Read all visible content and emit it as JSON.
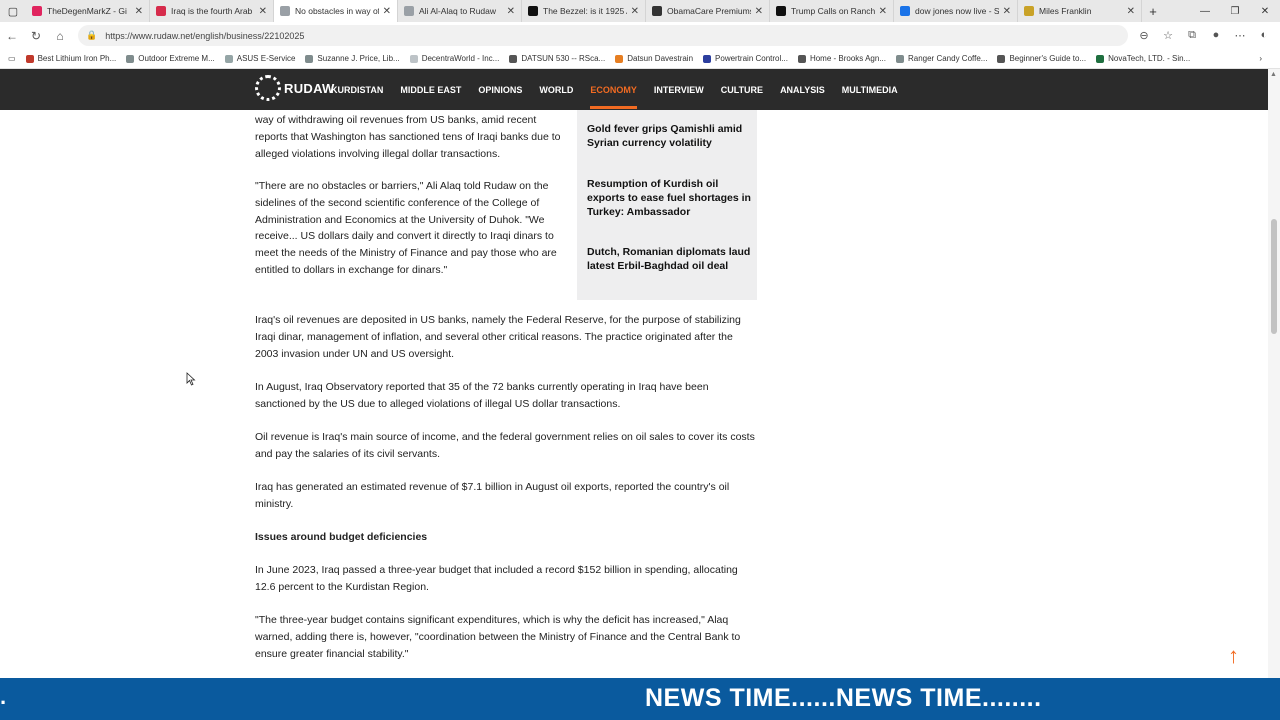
{
  "browser": {
    "tabs": [
      {
        "title": "TheDegenMarkZ - Gi",
        "color": "#e0245e",
        "active": false
      },
      {
        "title": "Iraq is the fourth Arab",
        "color": "#d62b4b",
        "active": false
      },
      {
        "title": "No obstacles in way of",
        "color": "#9aa0a6",
        "active": true
      },
      {
        "title": "Ali Al-Alaq to Rudaw",
        "color": "#9aa0a6",
        "active": false
      },
      {
        "title": "The Bezzel: is it 1925 A",
        "color": "#111111",
        "active": false
      },
      {
        "title": "ObamaCare Premiums",
        "color": "#333333",
        "active": false
      },
      {
        "title": "Trump Calls on Ranchers",
        "color": "#111111",
        "active": false
      },
      {
        "title": "dow jones now live - S",
        "color": "#1a73e8",
        "active": false
      },
      {
        "title": "Miles Franklin",
        "color": "#c9a227",
        "active": false
      }
    ],
    "url": "https://www.rudaw.net/english/business/22102025",
    "bookmarks": [
      {
        "label": "Best Lithium Iron Ph...",
        "color": "#c0392b"
      },
      {
        "label": "Outdoor Extreme M...",
        "color": "#7f8c8d"
      },
      {
        "label": "ASUS E-Service",
        "color": "#95a5a6"
      },
      {
        "label": "Suzanne J. Price, Lib...",
        "color": "#7f8c8d"
      },
      {
        "label": "DecentraWorld - Inc...",
        "color": "#bdc3c7"
      },
      {
        "label": "DATSUN 530 -- RSca...",
        "color": "#555555"
      },
      {
        "label": "Datsun Davestrain",
        "color": "#e67e22"
      },
      {
        "label": "Powertrain Control...",
        "color": "#2c3e9e"
      },
      {
        "label": "Home - Brooks Agn...",
        "color": "#555555"
      },
      {
        "label": "Ranger Candy Coffe...",
        "color": "#7f8c8d"
      },
      {
        "label": "Beginner's Guide to...",
        "color": "#555555"
      },
      {
        "label": "NovaTech, LTD. - Sin...",
        "color": "#1f6f3f"
      }
    ]
  },
  "site": {
    "logo": "RUDAW",
    "menu": [
      "KURDISTAN",
      "MIDDLE EAST",
      "OPINIONS",
      "WORLD",
      "ECONOMY",
      "INTERVIEW",
      "CULTURE",
      "ANALYSIS",
      "MULTIMEDIA"
    ],
    "active_menu_index": 4,
    "accent_color": "#f26b22"
  },
  "article": {
    "p1": "way of withdrawing oil revenues from US banks, amid recent reports that Washington has sanctioned tens of Iraqi banks due to alleged violations involving illegal dollar transactions.",
    "p2": "\"There are no obstacles or barriers,\" Ali Alaq told Rudaw on the sidelines of the second scientific conference of the College of Administration and Economics at the University of Duhok. \"We receive... US dollars daily and convert it directly to Iraqi dinars to meet the needs of the Ministry of Finance and pay those who are entitled to dollars in exchange for dinars.\"",
    "p3": "Iraq's oil revenues are deposited in US banks, namely the Federal Reserve, for the purpose of stabilizing Iraqi dinar, management of inflation, and several other critical reasons. The practice originated after the 2003 invasion under UN and US oversight.",
    "p4": "In August, Iraq Observatory reported that 35 of the 72 banks currently operating in Iraq have been sanctioned by the US due to alleged violations of illegal US dollar transactions.",
    "p5": "Oil revenue is Iraq's main source of income, and the federal government relies on oil sales to cover its costs and pay the salaries of its civil servants.",
    "p6": "Iraq has generated an estimated revenue of $7.1 billion in August oil exports, reported the country's oil ministry.",
    "subheading": "Issues around budget deficiencies",
    "p7": "In June 2023, Iraq passed a three-year budget that included a record $152 billion in spending, allocating 12.6 percent to the Kurdistan Region.",
    "p8": "\"The three-year budget contains significant expenditures, which is why the deficit has increased,\" Alaq warned, adding there is, however, \"coordination between the Ministry of Finance and the Central Bank to ensure greater financial stability.\""
  },
  "related": [
    "Gold fever grips Qamishli amid Syrian currency volatility",
    "Resumption of Kurdish oil exports to ease fuel shortages in Turkey: Ambassador",
    "Dutch, Romanian diplomats laud latest Erbil-Baghdad oil deal"
  ],
  "ticker": {
    "left": ".",
    "text": "NEWS TIME......NEWS TIME........",
    "bg": "#0a5a9e"
  },
  "icons": [
    "tab-actions-icon",
    "close-icon",
    "new-tab-icon",
    "back-icon",
    "refresh-icon",
    "home-icon",
    "lock-icon",
    "read-aloud-icon",
    "favorite-icon",
    "collections-icon",
    "profile-icon",
    "more-icon",
    "copilot-icon",
    "back-to-top-icon"
  ]
}
